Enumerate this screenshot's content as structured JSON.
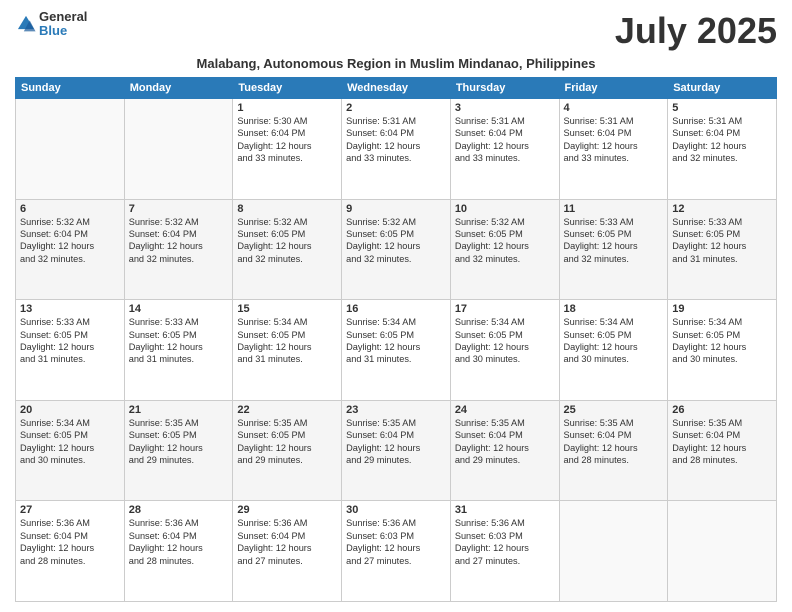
{
  "header": {
    "logo_general": "General",
    "logo_blue": "Blue",
    "month_title": "July 2025",
    "subtitle": "Malabang, Autonomous Region in Muslim Mindanao, Philippines"
  },
  "weekdays": [
    "Sunday",
    "Monday",
    "Tuesday",
    "Wednesday",
    "Thursday",
    "Friday",
    "Saturday"
  ],
  "weeks": [
    [
      {
        "day": "",
        "info": ""
      },
      {
        "day": "",
        "info": ""
      },
      {
        "day": "1",
        "info": "Sunrise: 5:30 AM\nSunset: 6:04 PM\nDaylight: 12 hours\nand 33 minutes."
      },
      {
        "day": "2",
        "info": "Sunrise: 5:31 AM\nSunset: 6:04 PM\nDaylight: 12 hours\nand 33 minutes."
      },
      {
        "day": "3",
        "info": "Sunrise: 5:31 AM\nSunset: 6:04 PM\nDaylight: 12 hours\nand 33 minutes."
      },
      {
        "day": "4",
        "info": "Sunrise: 5:31 AM\nSunset: 6:04 PM\nDaylight: 12 hours\nand 33 minutes."
      },
      {
        "day": "5",
        "info": "Sunrise: 5:31 AM\nSunset: 6:04 PM\nDaylight: 12 hours\nand 32 minutes."
      }
    ],
    [
      {
        "day": "6",
        "info": "Sunrise: 5:32 AM\nSunset: 6:04 PM\nDaylight: 12 hours\nand 32 minutes."
      },
      {
        "day": "7",
        "info": "Sunrise: 5:32 AM\nSunset: 6:04 PM\nDaylight: 12 hours\nand 32 minutes."
      },
      {
        "day": "8",
        "info": "Sunrise: 5:32 AM\nSunset: 6:05 PM\nDaylight: 12 hours\nand 32 minutes."
      },
      {
        "day": "9",
        "info": "Sunrise: 5:32 AM\nSunset: 6:05 PM\nDaylight: 12 hours\nand 32 minutes."
      },
      {
        "day": "10",
        "info": "Sunrise: 5:32 AM\nSunset: 6:05 PM\nDaylight: 12 hours\nand 32 minutes."
      },
      {
        "day": "11",
        "info": "Sunrise: 5:33 AM\nSunset: 6:05 PM\nDaylight: 12 hours\nand 32 minutes."
      },
      {
        "day": "12",
        "info": "Sunrise: 5:33 AM\nSunset: 6:05 PM\nDaylight: 12 hours\nand 31 minutes."
      }
    ],
    [
      {
        "day": "13",
        "info": "Sunrise: 5:33 AM\nSunset: 6:05 PM\nDaylight: 12 hours\nand 31 minutes."
      },
      {
        "day": "14",
        "info": "Sunrise: 5:33 AM\nSunset: 6:05 PM\nDaylight: 12 hours\nand 31 minutes."
      },
      {
        "day": "15",
        "info": "Sunrise: 5:34 AM\nSunset: 6:05 PM\nDaylight: 12 hours\nand 31 minutes."
      },
      {
        "day": "16",
        "info": "Sunrise: 5:34 AM\nSunset: 6:05 PM\nDaylight: 12 hours\nand 31 minutes."
      },
      {
        "day": "17",
        "info": "Sunrise: 5:34 AM\nSunset: 6:05 PM\nDaylight: 12 hours\nand 30 minutes."
      },
      {
        "day": "18",
        "info": "Sunrise: 5:34 AM\nSunset: 6:05 PM\nDaylight: 12 hours\nand 30 minutes."
      },
      {
        "day": "19",
        "info": "Sunrise: 5:34 AM\nSunset: 6:05 PM\nDaylight: 12 hours\nand 30 minutes."
      }
    ],
    [
      {
        "day": "20",
        "info": "Sunrise: 5:34 AM\nSunset: 6:05 PM\nDaylight: 12 hours\nand 30 minutes."
      },
      {
        "day": "21",
        "info": "Sunrise: 5:35 AM\nSunset: 6:05 PM\nDaylight: 12 hours\nand 29 minutes."
      },
      {
        "day": "22",
        "info": "Sunrise: 5:35 AM\nSunset: 6:05 PM\nDaylight: 12 hours\nand 29 minutes."
      },
      {
        "day": "23",
        "info": "Sunrise: 5:35 AM\nSunset: 6:04 PM\nDaylight: 12 hours\nand 29 minutes."
      },
      {
        "day": "24",
        "info": "Sunrise: 5:35 AM\nSunset: 6:04 PM\nDaylight: 12 hours\nand 29 minutes."
      },
      {
        "day": "25",
        "info": "Sunrise: 5:35 AM\nSunset: 6:04 PM\nDaylight: 12 hours\nand 28 minutes."
      },
      {
        "day": "26",
        "info": "Sunrise: 5:35 AM\nSunset: 6:04 PM\nDaylight: 12 hours\nand 28 minutes."
      }
    ],
    [
      {
        "day": "27",
        "info": "Sunrise: 5:36 AM\nSunset: 6:04 PM\nDaylight: 12 hours\nand 28 minutes."
      },
      {
        "day": "28",
        "info": "Sunrise: 5:36 AM\nSunset: 6:04 PM\nDaylight: 12 hours\nand 28 minutes."
      },
      {
        "day": "29",
        "info": "Sunrise: 5:36 AM\nSunset: 6:04 PM\nDaylight: 12 hours\nand 27 minutes."
      },
      {
        "day": "30",
        "info": "Sunrise: 5:36 AM\nSunset: 6:03 PM\nDaylight: 12 hours\nand 27 minutes."
      },
      {
        "day": "31",
        "info": "Sunrise: 5:36 AM\nSunset: 6:03 PM\nDaylight: 12 hours\nand 27 minutes."
      },
      {
        "day": "",
        "info": ""
      },
      {
        "day": "",
        "info": ""
      }
    ]
  ]
}
